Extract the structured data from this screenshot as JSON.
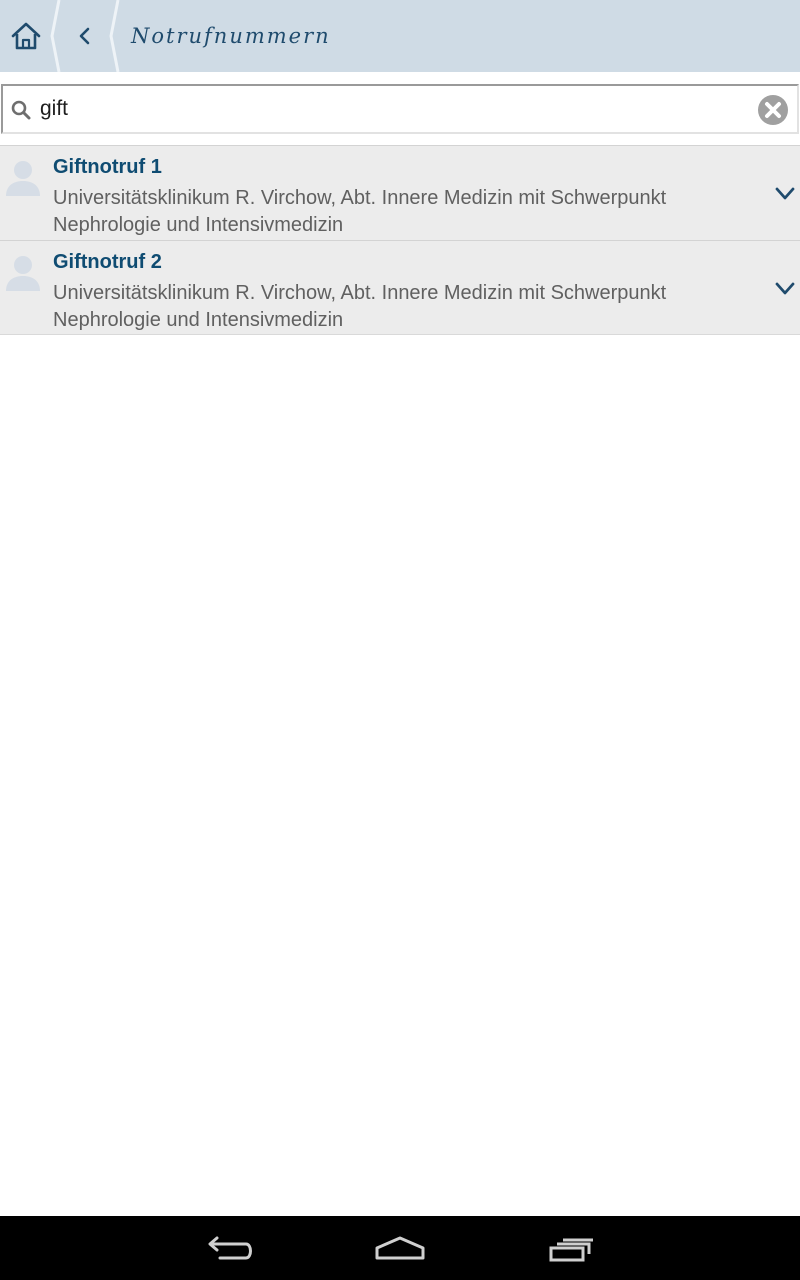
{
  "header": {
    "title": "Notrufnummern",
    "home_icon": "home-icon",
    "back_icon": "chevron-left-icon",
    "background": "#cfdbe5",
    "accent": "#1f4b6d"
  },
  "search": {
    "value": "gift",
    "placeholder": "",
    "search_icon": "search-icon",
    "clear_icon": "clear-circle-x-icon"
  },
  "results": [
    {
      "title": "Giftnotruf 1",
      "description": "Universitätsklinikum R. Virchow, Abt. Innere Medizin mit Schwerpunkt Nephrologie und Intensivmedizin",
      "avatar_icon": "person-placeholder-icon",
      "expand_icon": "chevron-down-icon"
    },
    {
      "title": "Giftnotruf 2",
      "description": "Universitätsklinikum R. Virchow, Abt. Innere Medizin mit Schwerpunkt Nephrologie und Intensivmedizin",
      "avatar_icon": "person-placeholder-icon",
      "expand_icon": "chevron-down-icon"
    }
  ],
  "system_nav": {
    "back_icon": "nav-back-icon",
    "home_icon": "nav-home-icon",
    "recents_icon": "nav-recents-icon"
  }
}
